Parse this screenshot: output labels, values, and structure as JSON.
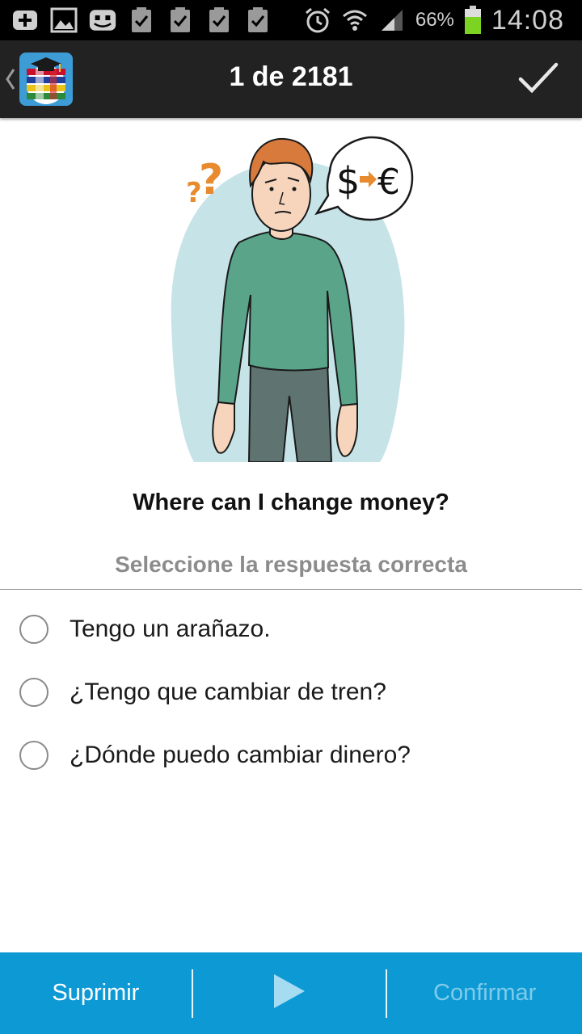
{
  "status_bar": {
    "battery_percent": "66%",
    "time": "14:08",
    "left_icons": [
      "add-icon",
      "gallery-icon",
      "messenger-icon",
      "clipboard-check-icon",
      "clipboard-check-icon",
      "clipboard-check-icon",
      "clipboard-check-icon"
    ],
    "right_icons": [
      "alarm-icon",
      "wifi-icon",
      "signal-icon",
      "battery-icon"
    ]
  },
  "action_bar": {
    "title": "1 de 2181",
    "logo": "app-logo-globe-graduation-cap",
    "check_icon": "checkmark-icon"
  },
  "main": {
    "illustration": "man-thinking-currency-exchange",
    "question": "Where can I change money?",
    "instruction": "Seleccione la respuesta correcta",
    "options": [
      {
        "label": "Tengo un arañazo.",
        "selected": false
      },
      {
        "label": "¿Tengo que cambiar de tren?",
        "selected": false
      },
      {
        "label": "¿Dónde puedo cambiar dinero?",
        "selected": false
      }
    ]
  },
  "bottom_bar": {
    "delete_label": "Suprimir",
    "play_icon": "play-icon",
    "confirm_label": "Confirmar",
    "colors": {
      "background": "#0d9ad4",
      "confirm_disabled": "#7fcbea"
    }
  }
}
